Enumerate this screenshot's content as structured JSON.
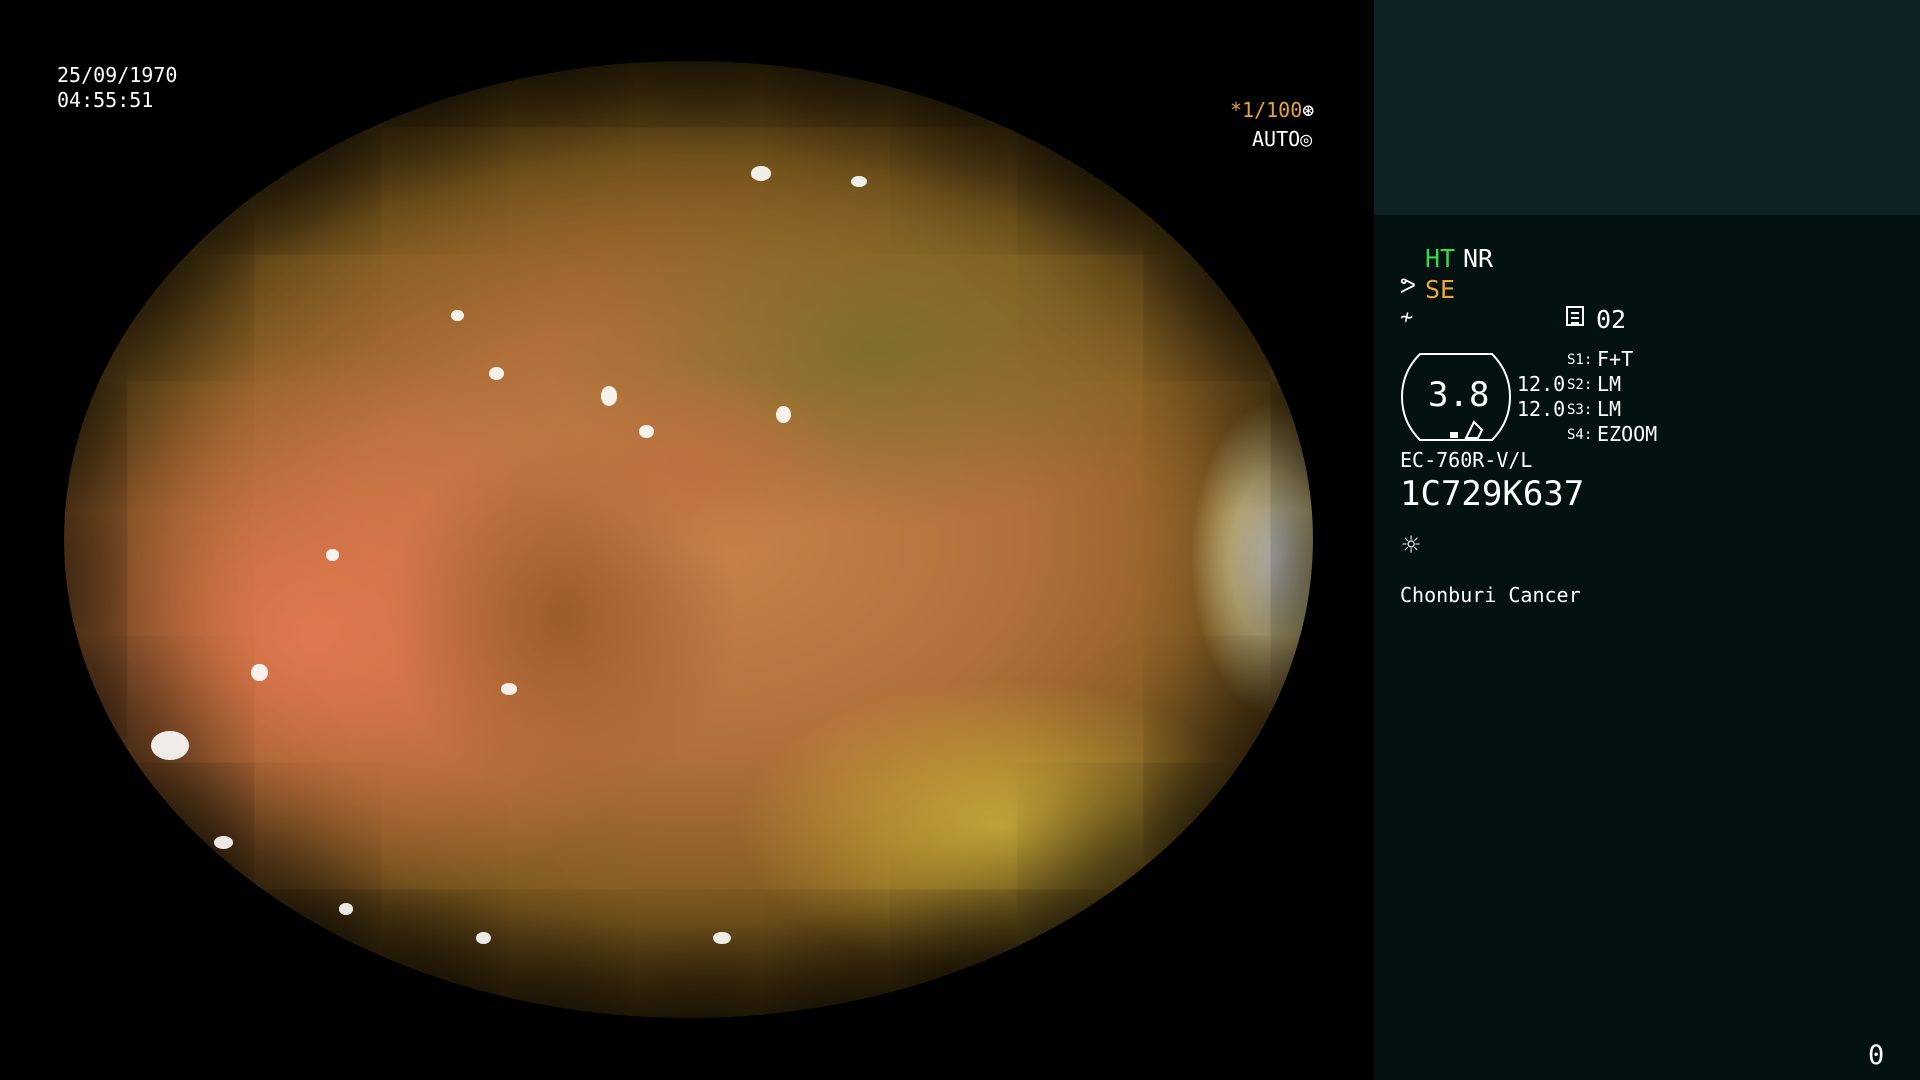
{
  "overlay": {
    "date": "25/09/1970",
    "time": "04:55:51",
    "shutter": "*1/100",
    "shutter_icon": "aperture-icon",
    "iris": "AUTO",
    "iris_icon": "iris-icon"
  },
  "panel": {
    "ht": "HT",
    "nr": "NR",
    "se_icon": "scope-icon",
    "se": "SE",
    "ne_icon": "enhancement-icon",
    "memory_icon": "memory-icon",
    "memory": "02",
    "zoom": "3.8",
    "preset_1": "12.0",
    "preset_2": "12.0",
    "switches": [
      {
        "label": "S1:",
        "value": "F+T"
      },
      {
        "label": "S2:",
        "value": "LM"
      },
      {
        "label": "S3:",
        "value": "LM"
      },
      {
        "label": "S4:",
        "value": "EZOOM"
      }
    ],
    "model": "EC-760R-V/L",
    "serial": "1C729K637",
    "light_icon": "light-source-icon",
    "hospital": "Chonburi Cancer",
    "counter": "0"
  },
  "colors": {
    "ht": "#36d94a",
    "se": "#f2a52c",
    "shutter": "#e8a23a",
    "panel_top": "#0d2224",
    "panel": "#031210"
  }
}
